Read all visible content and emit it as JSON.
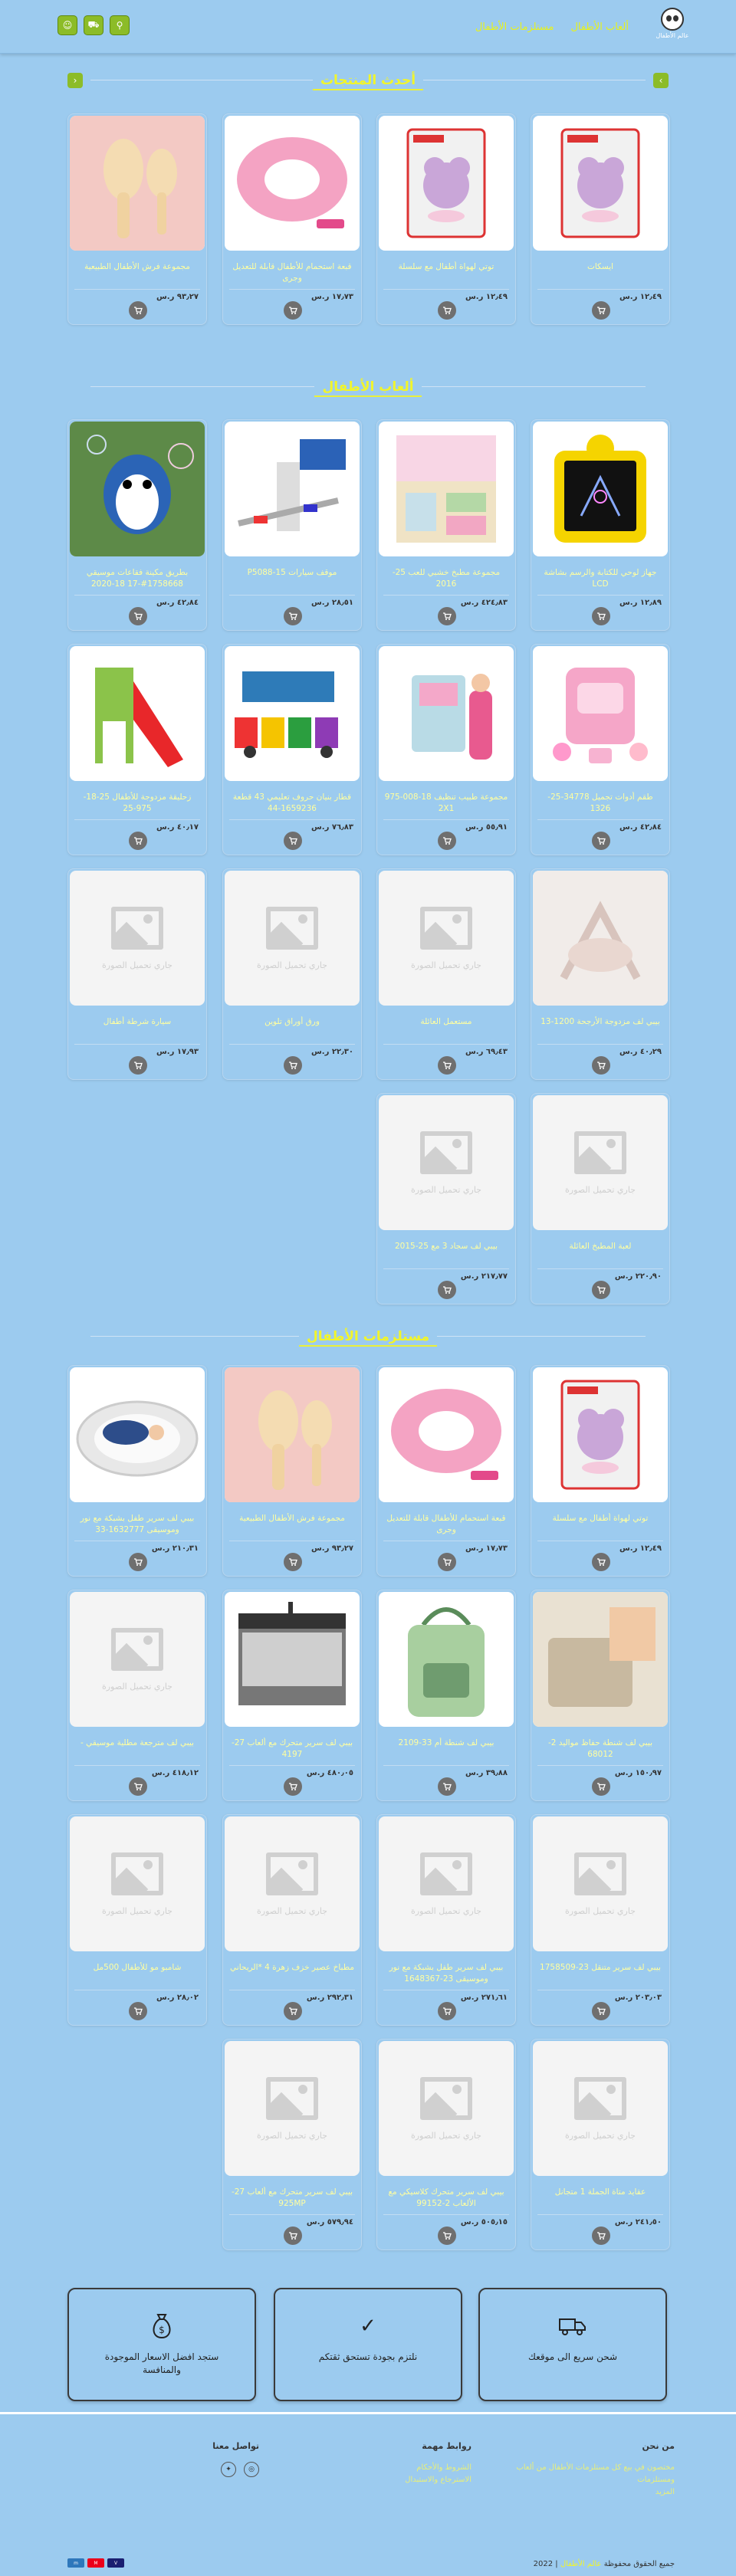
{
  "header": {
    "logo_text": "عالم الأطفال",
    "nav": [
      "ألعاب الأطفال",
      "مستلزمات الأطفال"
    ]
  },
  "sections": {
    "latest": "أحدث المنتجات",
    "toys": "ألعاب الأطفال",
    "supplies": "مستلزمات الأطفال"
  },
  "currency": "ر.س",
  "placeholder_text": "جاري تحميل الصورة",
  "latest": [
    {
      "name": "ايسكات",
      "price": "١٢٫٤٩",
      "img": "teether"
    },
    {
      "name": "توتي لهواة أطفال مع سلسلة",
      "price": "١٢٫٤٩",
      "img": "teether"
    },
    {
      "name": "قبعة استحمام للأطفال قابلة للتعديل وجرى",
      "price": "١٧٫٧٣",
      "img": "cap"
    },
    {
      "name": "مجموعة فرش الأطفال الطبيعية",
      "price": "٩٣٫٢٧",
      "img": "brush"
    }
  ],
  "toys": [
    {
      "name": "جهاز لوحي للكتابة والرسم بشاشة LCD",
      "price": "١٢٫٨٩",
      "img": "tablet"
    },
    {
      "name": "مجموعة مطبخ خشبي للعب 25-2016",
      "price": "٤٢٤٫٨٣",
      "img": "kitchen"
    },
    {
      "name": "موقف سيارات P5088-15",
      "price": "٢٨٫٥١",
      "img": "parking"
    },
    {
      "name": "بطريق مكينة فقاعات موسيقي 1758668#-17 18-2020",
      "price": "٤٢٫٨٤",
      "img": "bubbles"
    },
    {
      "name": "طقم أدوات تجميل 34778-25-1326",
      "price": "٤٢٫٨٤",
      "img": "beauty"
    },
    {
      "name": "مجموعة طبيب تنظيف 18-008-975 2X1",
      "price": "٥٥٫٩١",
      "img": "doctor"
    },
    {
      "name": "قطار بنيان حروف تعليمي 43 قطعة 1659236-44",
      "price": "٧٦٫٨٣",
      "img": "train"
    },
    {
      "name": "زحليقة مزدوجة للأطفال 25-18-975-25",
      "price": "٤٠٫١٧",
      "img": "slide"
    },
    {
      "name": "بيبي لف مزدوجة الأرجحة 1200-13",
      "price": "٤٠٫٢٩",
      "img": "bouncer"
    },
    {
      "name": "مستعمل العائلة",
      "price": "٦٩٫٤٣",
      "img": "ph"
    },
    {
      "name": "ورق أوراق تلوين",
      "price": "٢٢٫٣٠",
      "img": "ph"
    },
    {
      "name": "سيارة شرطة أطفال",
      "price": "١٧٫٩٣",
      "img": "ph"
    },
    {
      "name": "لعبة المطبخ العائلة",
      "price": "٢٢٠٫٩٠",
      "img": "ph"
    },
    {
      "name": "بيبي لف سجاد 3 مع 25-2015",
      "price": "٢١٧٫٧٧",
      "img": "ph"
    }
  ],
  "supplies": [
    {
      "name": "توتي لهواة أطفال مع سلسلة",
      "price": "١٢٫٤٩",
      "img": "teether"
    },
    {
      "name": "قبعة استحمام للأطفال قابلة للتعديل وجرى",
      "price": "١٧٫٧٣",
      "img": "cap"
    },
    {
      "name": "مجموعة فرش الأطفال الطبيعية",
      "price": "٩٣٫٢٧",
      "img": "brush"
    },
    {
      "name": "بيبي لف سرير طفل بشبكة مع نور وموسيقى 1632777-33",
      "price": "٢١٠٫٣١",
      "img": "bed"
    },
    {
      "name": "بيبي لف شنطة حفاظ مواليد 2-68012",
      "price": "١٥٠٫٩٧",
      "img": "diaperbag"
    },
    {
      "name": "بيبي لف شنطة أم 33-2109",
      "price": "٣٩٫٨٨",
      "img": "greenbag"
    },
    {
      "name": "بيبي لف سرير متحرك مع ألعاب 27-4197",
      "price": "٤٨٠٫٠٥",
      "img": "crib"
    },
    {
      "name": "بيبي لف مترجعة مطلية موسيقي -",
      "price": "٤١٨٫١٢",
      "img": "ph"
    },
    {
      "name": "بيبي لف سرير متنقل 23-1758509",
      "price": "٢٠٣٫٠٣",
      "img": "ph"
    },
    {
      "name": "بيبي لف سرير طفل بشبكة مع نور وموسيقى 23-1648367",
      "price": "٢٧١٫٦١",
      "img": "ph"
    },
    {
      "name": "مطباخ عصير خزف زهرة 4 *الريحاني",
      "price": "٢٩٢٫٣١",
      "img": "ph"
    },
    {
      "name": "شامبو مو للأطفال 500مل",
      "price": "٢٨٫٠٢",
      "img": "ph"
    },
    {
      "name": "عقايد متاة الجملة 1 متجانل",
      "price": "٢٤١٫٥٠",
      "img": "ph"
    },
    {
      "name": "بيبي لف سرير متحرك كلاسيكي مع الألعاب 2-99152",
      "price": "٥٠٥٫١٥",
      "img": "ph"
    },
    {
      "name": "بيبي لف سرير متحرك مع ألعاب 27-925MP",
      "price": "٥٧٩٫٩٤",
      "img": "ph"
    }
  ],
  "features": [
    {
      "icon": "truck-icon",
      "text": "شحن سريع الى موقعك"
    },
    {
      "icon": "check-icon",
      "text": "نلتزم بجودة تستحق ثقتكم"
    },
    {
      "icon": "money-bag-icon",
      "text": "ستجد افضل الاسعار الموجودة والمنافسة"
    }
  ],
  "footer": {
    "about_title": "من نحن",
    "about_text": "مختصون في بيع كل مستلزمات الأطفال من ألعاب ومستلزمات",
    "about_more": "المزيد",
    "links_title": "روابط مهمة",
    "links": [
      "الشروط والأحكام",
      "الاسترجاع والاستبدال"
    ],
    "contact_title": "تواصل معنا",
    "copyright": "جميع الحقوق محفوظة",
    "year": "2022",
    "brand": "عالم الأطفال"
  },
  "colors": {
    "bg": "#9ccbef",
    "accent": "#8cbc28",
    "title": "#f1f52b"
  }
}
